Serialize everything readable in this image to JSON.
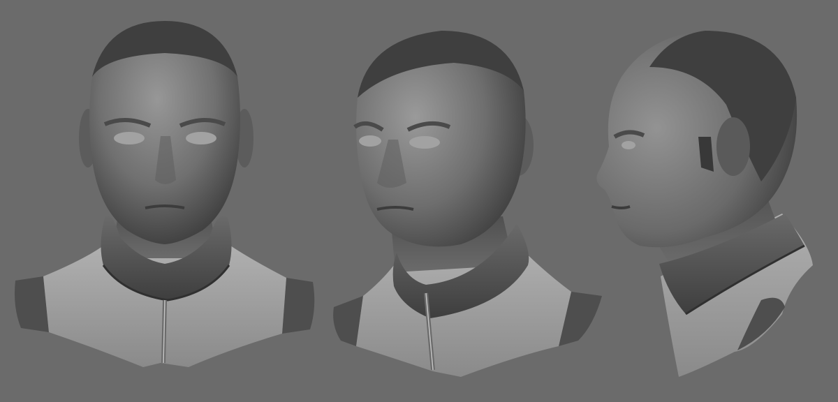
{
  "scene": {
    "background": "#6b6b6b",
    "material": "clay-grey-sculpt",
    "views": [
      {
        "id": "front",
        "label_visible": false
      },
      {
        "id": "three-quarter",
        "label_visible": false
      },
      {
        "id": "profile",
        "label_visible": false
      }
    ]
  },
  "colors": {
    "background": "#6b6b6b",
    "skin_light": "#8d8d8d",
    "skin_mid": "#6e6e6e",
    "skin_dark": "#3c3c3c",
    "collar": "#5a5a5a",
    "shirt_light": "#a8a8a8",
    "shirt_mid": "#8b8b8b",
    "shoulder_pad": "#4e4e4e"
  }
}
